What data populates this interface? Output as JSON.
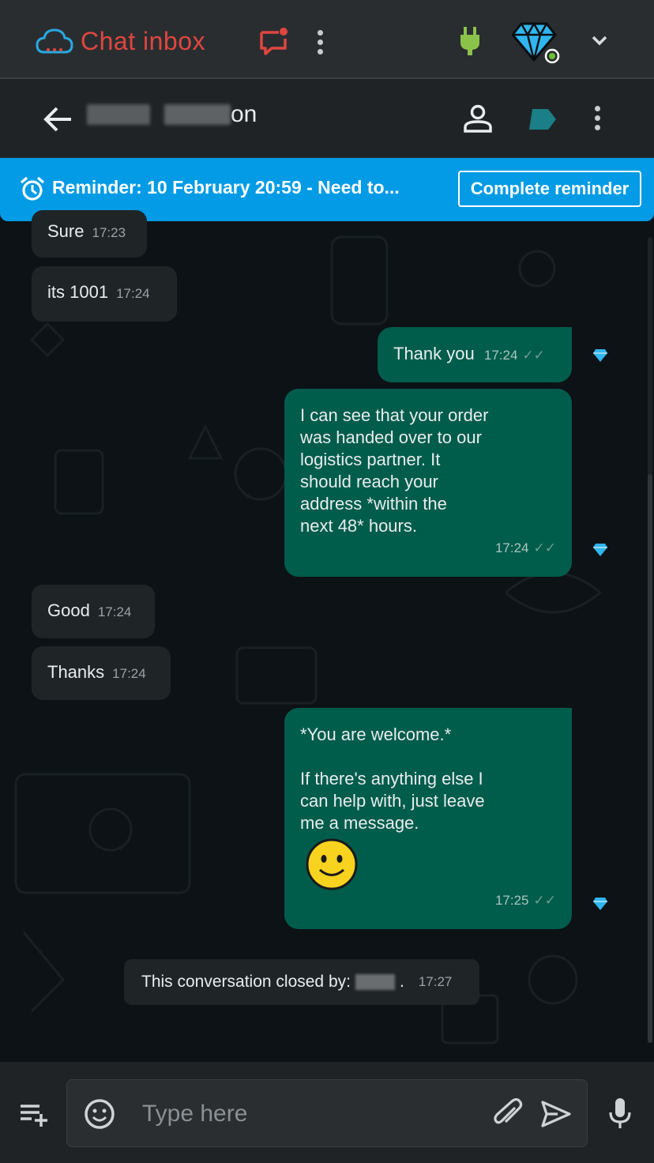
{
  "app": {
    "title": "Chat inbox",
    "accent_color": "#e0463f",
    "brand_icon": "cloud-logo-icon"
  },
  "topbar": {
    "notification_icon": "chat-notification-icon",
    "menu_icon": "more-vertical-icon",
    "plugin_icon": "plug-icon",
    "plan_icon": "diamond-icon",
    "dropdown_icon": "chevron-down-icon"
  },
  "header": {
    "contact_name_suffix": "on",
    "back_icon": "arrow-left-icon",
    "profile_icon": "person-icon",
    "label_icon": "tag-icon",
    "menu_icon": "more-vertical-icon"
  },
  "reminder": {
    "text": "Reminder: 10 February 20:59  -   Need to...",
    "button_label": "Complete reminder",
    "icon": "alarm-clock-icon",
    "color": "#039be5"
  },
  "messages": [
    {
      "direction": "in",
      "text": "Sure",
      "time": "17:23"
    },
    {
      "direction": "in",
      "text": "its 1001",
      "time": "17:24"
    },
    {
      "direction": "out",
      "text": "Thank you",
      "time": "17:24"
    },
    {
      "direction": "out",
      "lines": [
        "I can see that your order",
        "was handed over to our",
        "logistics partner. It",
        "should reach your",
        "address *within the",
        "next 48* hours."
      ],
      "time": "17:24"
    },
    {
      "direction": "in",
      "text": "Good",
      "time": "17:24"
    },
    {
      "direction": "in",
      "text": "Thanks",
      "time": "17:24"
    },
    {
      "direction": "out",
      "lines": [
        "*You are welcome.*",
        "",
        "If there's anything else I",
        "can help with, just leave",
        "me a message."
      ],
      "emoji": "🙂",
      "time": "17:25"
    }
  ],
  "system_message": {
    "text_before": "This conversation closed by:",
    "text_after": ".",
    "time": "17:27"
  },
  "composer": {
    "placeholder": "Type here",
    "quick_reply_icon": "playlist-add-icon",
    "emoji_icon": "emoji-icon",
    "attach_icon": "paperclip-icon",
    "send_icon": "send-icon",
    "mic_icon": "microphone-icon"
  }
}
